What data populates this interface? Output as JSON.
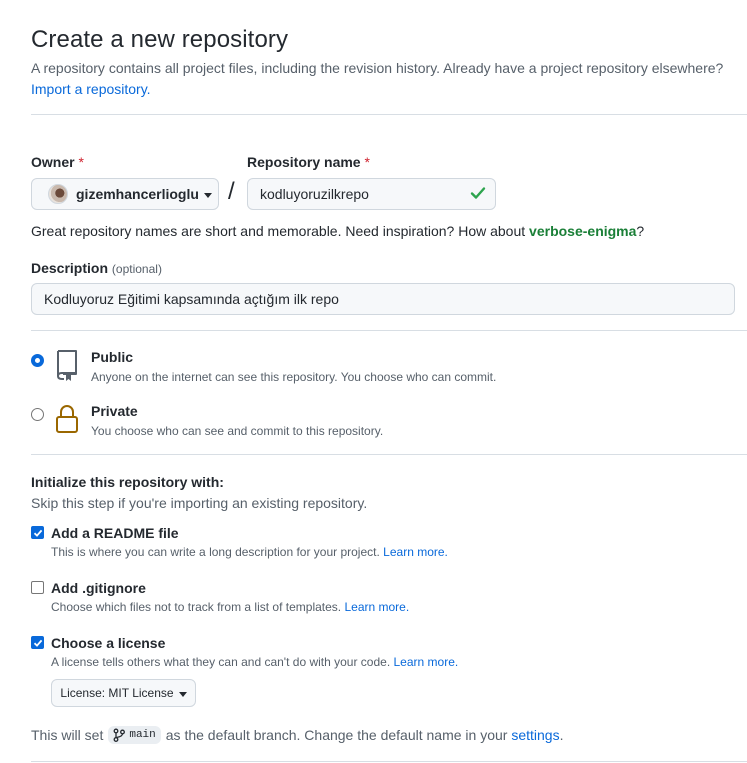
{
  "header": {
    "title": "Create a new repository",
    "subtitle": "A repository contains all project files, including the revision history. Already have a project repository elsewhere?",
    "import_link": "Import a repository."
  },
  "owner": {
    "label": "Owner",
    "required_mark": "*",
    "value": "gizemhancerlioglu",
    "icon": "avatar"
  },
  "repo_name": {
    "label": "Repository name",
    "required_mark": "*",
    "value": "kodluyoruzilkrepo",
    "valid_icon": "check-icon",
    "valid_color": "#1a7f37"
  },
  "separator": "/",
  "hint": {
    "text": "Great repository names are short and memorable. Need inspiration? How about",
    "suggestion": "verbose-enigma",
    "end": "?"
  },
  "description": {
    "label": "Description",
    "optional": "(optional)",
    "value": "Kodluyoruz Eğitimi kapsamında açtığım ilk repo"
  },
  "visibility": {
    "selected": "public",
    "options": [
      {
        "id": "public",
        "title": "Public",
        "desc": "Anyone on the internet can see this repository. You choose who can commit.",
        "icon": "repo-icon"
      },
      {
        "id": "private",
        "title": "Private",
        "desc": "You choose who can see and commit to this repository.",
        "icon": "lock-icon"
      }
    ]
  },
  "init": {
    "heading": "Initialize this repository with:",
    "subheading": "Skip this step if you're importing an existing repository.",
    "options": [
      {
        "id": "readme",
        "checked": true,
        "title": "Add a README file",
        "desc": "This is where you can write a long description for your project.",
        "link": "Learn more."
      },
      {
        "id": "gitignore",
        "checked": false,
        "title": "Add .gitignore",
        "desc": "Choose which files not to track from a list of templates.",
        "link": "Learn more."
      },
      {
        "id": "license",
        "checked": true,
        "title": "Choose a license",
        "desc": "A license tells others what they can and can't do with your code.",
        "link": "Learn more."
      }
    ],
    "license_select": "License: MIT License"
  },
  "branch": {
    "prefix": "This will set",
    "name": "main",
    "icon": "git-branch-icon",
    "middle": "as the default branch. Change the default name in your",
    "settings_link": "settings",
    "end": "."
  },
  "colors": {
    "accent": "#0969da",
    "success": "#1a7f37",
    "danger": "#cf222e",
    "lock": "#9a6700"
  }
}
